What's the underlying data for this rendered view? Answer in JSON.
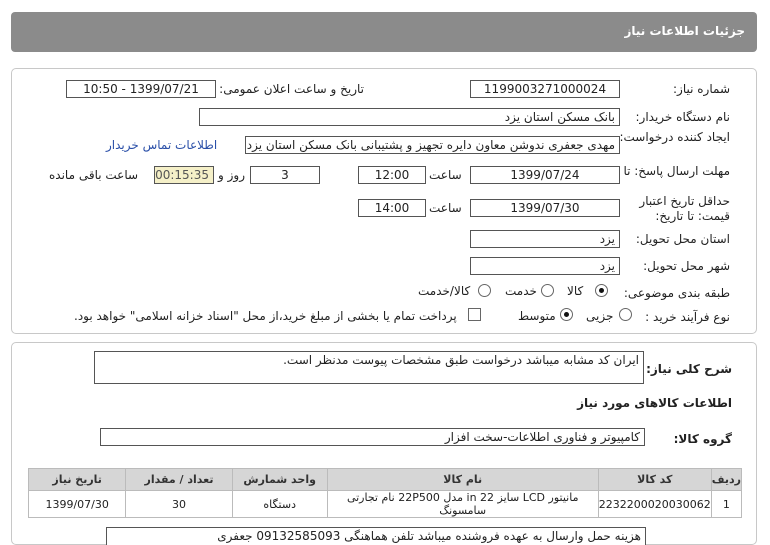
{
  "header": {
    "title": "جزئیات اطلاعات نیاز"
  },
  "form": {
    "need_number_label": "شماره نیاز:",
    "need_number": "1199003271000024",
    "announce_label": "تاریخ و ساعت اعلان عمومی:",
    "announce_value": "1399/07/21 - 10:50",
    "buyer_label": "نام دستگاه خریدار:",
    "buyer_value": "بانک مسکن استان یزد",
    "creator_label": "ایجاد کننده درخواست:",
    "creator_value": "مهدی  جعفری ندوشن معاون دایره تجهیز و پشتیبانی بانک مسکن استان یزد",
    "contact_link": "اطلاعات تماس خریدار",
    "reply_deadline_label": "مهلت ارسال پاسخ: تا تاریخ:",
    "reply_date": "1399/07/24",
    "hour_label": "ساعت",
    "reply_time": "12:00",
    "days_value": "3",
    "days_label": "روز و",
    "timer_value": "00:15:35",
    "remaining_label": "ساعت باقی مانده",
    "validity_label": "حداقل تاریخ اعتبار قیمت: تا تاریخ:",
    "validity_date": "1399/07/30",
    "validity_time": "14:00",
    "province_label": "استان محل تحویل:",
    "province_value": "یزد",
    "city_label": "شهر محل تحویل:",
    "city_value": "یزد",
    "category_label": "طبقه بندی موضوعی:",
    "category_options": [
      "کالا",
      "خدمت",
      "کالا/خدمت"
    ],
    "process_label": "نوع فرآیند خرید :",
    "process_options": [
      "جزیی",
      "متوسط"
    ],
    "payment_note": "پرداخت تمام یا بخشی از مبلغ خرید،از محل \"اسناد خزانه اسلامی\" خواهد بود."
  },
  "description": {
    "label": "شرح کلی نیاز:",
    "value": "ایران کد مشابه میباشد درخواست طبق مشخصات پیوست مدنظر است."
  },
  "goods": {
    "section_title": "اطلاعات کالاهای مورد نیاز",
    "group_label": "گروه کالا:",
    "group_value": "کامپیوتر و فناوری اطلاعات-سخت افزار",
    "columns": [
      "ردیف",
      "کد کالا",
      "نام کالا",
      "واحد شمارش",
      "تعداد / مقدار",
      "تاریخ نیاز"
    ],
    "rows": [
      [
        "1",
        "2232200020030062",
        "مانیتور LCD سایز 22 in مدل 22P500 نام تجارتی سامسونگ",
        "دستگاه",
        "30",
        "1399/07/30"
      ]
    ],
    "note": "هزینه حمل وارسال به عهده فروشنده میباشد تلفن هماهنگی 09132585093 جعفری"
  }
}
